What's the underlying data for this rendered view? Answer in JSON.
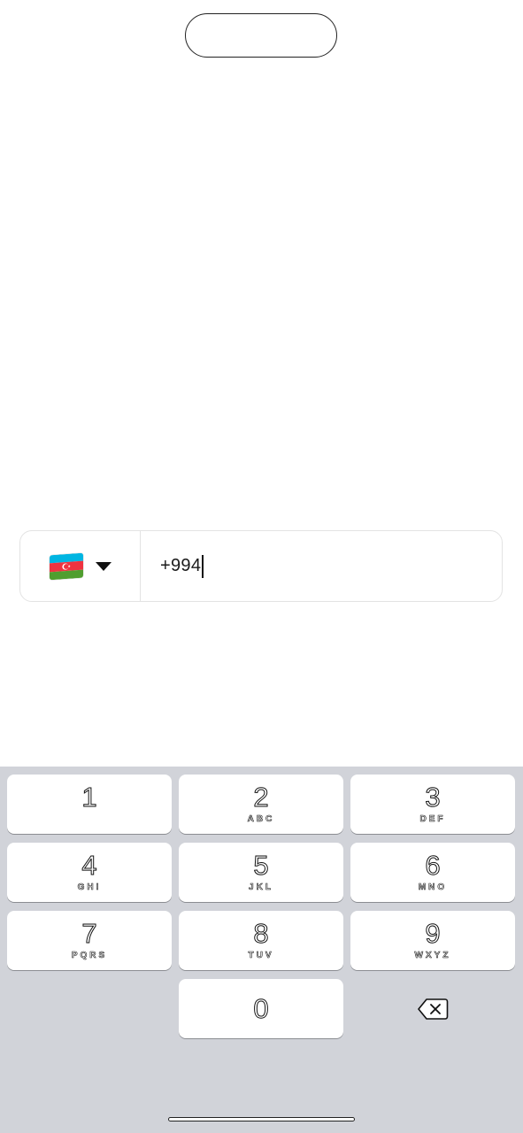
{
  "phone": {
    "country_flag": "azerbaijan-flag",
    "value": "+994",
    "flag_colors": [
      "#00b5e2",
      "#ef3340",
      "#509e2f"
    ]
  },
  "keyboard": {
    "keys": [
      {
        "digit": "1",
        "letters": ""
      },
      {
        "digit": "2",
        "letters": "ABC"
      },
      {
        "digit": "3",
        "letters": "DEF"
      },
      {
        "digit": "4",
        "letters": "GHI"
      },
      {
        "digit": "5",
        "letters": "JKL"
      },
      {
        "digit": "6",
        "letters": "MNO"
      },
      {
        "digit": "7",
        "letters": "PQRS"
      },
      {
        "digit": "8",
        "letters": "TUV"
      },
      {
        "digit": "9",
        "letters": "WXYZ"
      },
      {
        "digit": "0",
        "letters": ""
      }
    ],
    "backspace_icon": "backspace-icon",
    "background": "#d1d3d9"
  }
}
